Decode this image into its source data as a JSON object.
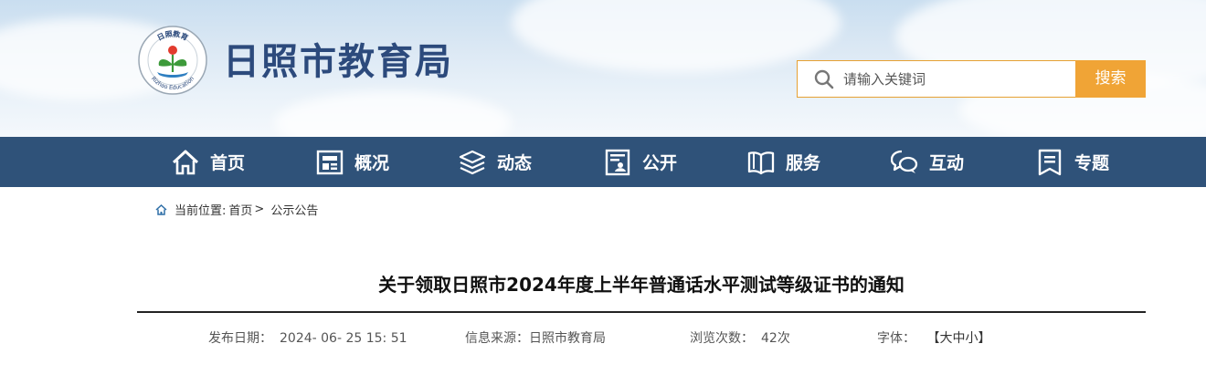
{
  "header": {
    "site_title": "日照市教育局",
    "emblem": {
      "top_text": "日照教育",
      "bottom_text": "Rizhao Education"
    },
    "search": {
      "placeholder": "请输入关键词",
      "button_label": "搜索"
    },
    "colors": {
      "brand": "#2c4a7c",
      "accent": "#f0a436"
    }
  },
  "nav": {
    "items": [
      {
        "label": "首页",
        "icon": "home-icon"
      },
      {
        "label": "概况",
        "icon": "overview-icon"
      },
      {
        "label": "动态",
        "icon": "layers-icon"
      },
      {
        "label": "公开",
        "icon": "disclosure-icon"
      },
      {
        "label": "服务",
        "icon": "book-icon"
      },
      {
        "label": "互动",
        "icon": "chat-icon"
      },
      {
        "label": "专题",
        "icon": "bookmark-icon"
      }
    ],
    "background": "#2f5279"
  },
  "breadcrumb": {
    "prefix": "当前位置:",
    "home": "首页",
    "separator": ">",
    "current": "公示公告"
  },
  "article": {
    "title": "关于领取日照市2024年度上半年普通话水平测试等级证书的通知",
    "meta": {
      "publish_label": "发布日期：",
      "publish_value": "2024- 06- 25 15: 51",
      "source_label": "信息来源：",
      "source_value": "日照市教育局",
      "views_label": "浏览次数：",
      "views_value": "42次",
      "font_label": "字体：",
      "font_open": "【",
      "font_large": "大",
      "font_medium": "中",
      "font_small": "小",
      "font_close": "】"
    }
  }
}
